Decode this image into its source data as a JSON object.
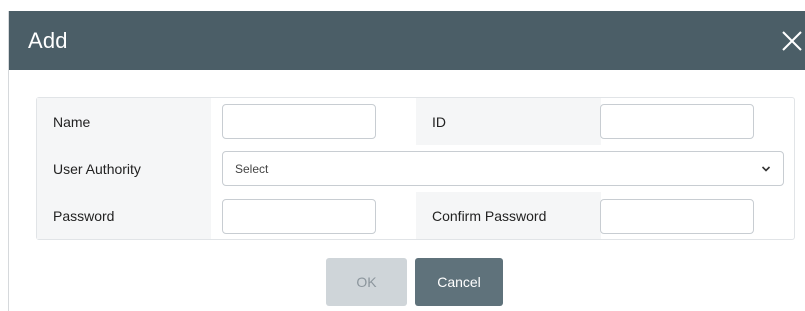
{
  "dialog": {
    "title": "Add",
    "close_icon": "close-icon"
  },
  "form": {
    "name_label": "Name",
    "name_value": "",
    "id_label": "ID",
    "id_value": "",
    "authority_label": "User Authority",
    "authority_selected": "Select",
    "authority_icon": "chevron-down-icon",
    "password_label": "Password",
    "password_value": "",
    "confirm_label": "Confirm Password",
    "confirm_value": ""
  },
  "buttons": {
    "ok_label": "OK",
    "cancel_label": "Cancel"
  },
  "colors": {
    "header_bg": "#4b5e67",
    "ok_disabled_bg": "#cfd5d9",
    "cancel_bg": "#5f727b",
    "label_cell_bg": "#f5f6f7"
  }
}
